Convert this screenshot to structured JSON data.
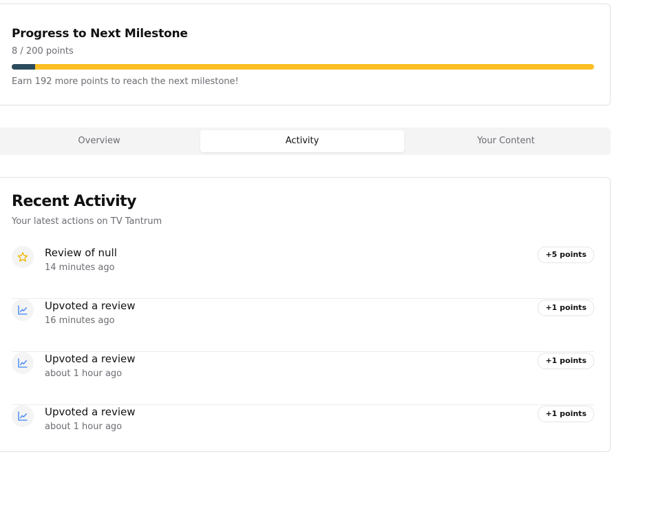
{
  "milestone": {
    "title": "Progress to Next Milestone",
    "points_text": "8 / 200 points",
    "current_points": 8,
    "target_points": 200,
    "hint": "Earn 192 more points to reach the next milestone!",
    "colors": {
      "fill": "#2b4c5e",
      "track": "#fbbf24"
    }
  },
  "tabs": [
    {
      "label": "Overview",
      "active": false
    },
    {
      "label": "Activity",
      "active": true
    },
    {
      "label": "Your Content",
      "active": false
    }
  ],
  "activity": {
    "heading": "Recent Activity",
    "subheading": "Your latest actions on TV Tantrum",
    "items": [
      {
        "icon": "star-icon",
        "title": "Review of null",
        "time": "14 minutes ago",
        "points": "+5 points"
      },
      {
        "icon": "trending-chart-icon",
        "title": "Upvoted a review",
        "time": "16 minutes ago",
        "points": "+1 points"
      },
      {
        "icon": "trending-chart-icon",
        "title": "Upvoted a review",
        "time": "about 1 hour ago",
        "points": "+1 points"
      },
      {
        "icon": "trending-chart-icon",
        "title": "Upvoted a review",
        "time": "about 1 hour ago",
        "points": "+1 points"
      }
    ],
    "colors": {
      "star": "#f0b400",
      "chart": "#3b82f6"
    }
  }
}
